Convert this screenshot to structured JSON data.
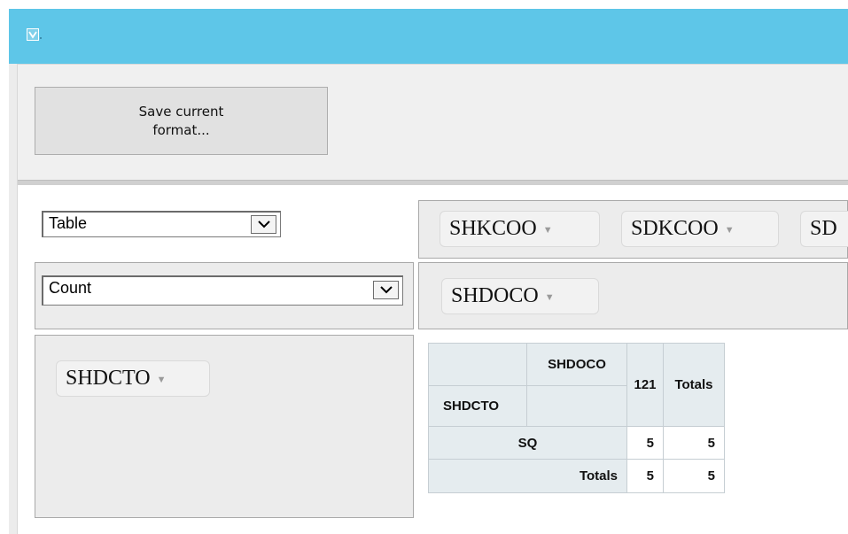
{
  "toolbar": {
    "save_label": "Save current format..."
  },
  "renderer_select": {
    "value": "Table"
  },
  "aggregator_select": {
    "value": "Count"
  },
  "column_fields": [
    {
      "label": "SHKCOO"
    },
    {
      "label": "SDKCOO"
    },
    {
      "label": "SD"
    }
  ],
  "value_fields": [
    {
      "label": "SHDOCO"
    }
  ],
  "row_fields": [
    {
      "label": "SHDCTO"
    }
  ],
  "pivot_table": {
    "col_attr": "SHDOCO",
    "row_attr": "SHDCTO",
    "col_value": "121",
    "totals_label": "Totals",
    "rows": [
      {
        "label": "SQ",
        "value": "5",
        "total": "5"
      }
    ],
    "totals_row": {
      "label": "Totals",
      "value": "5",
      "total": "5"
    }
  },
  "icons": {
    "app": "app-logo-icon",
    "dropdown": "chevron-down-icon",
    "field_menu": "triangle-down-icon"
  },
  "colors": {
    "titlebar": "#5ec6e8",
    "panel": "#ececec",
    "table_header": "#e5ecef"
  }
}
